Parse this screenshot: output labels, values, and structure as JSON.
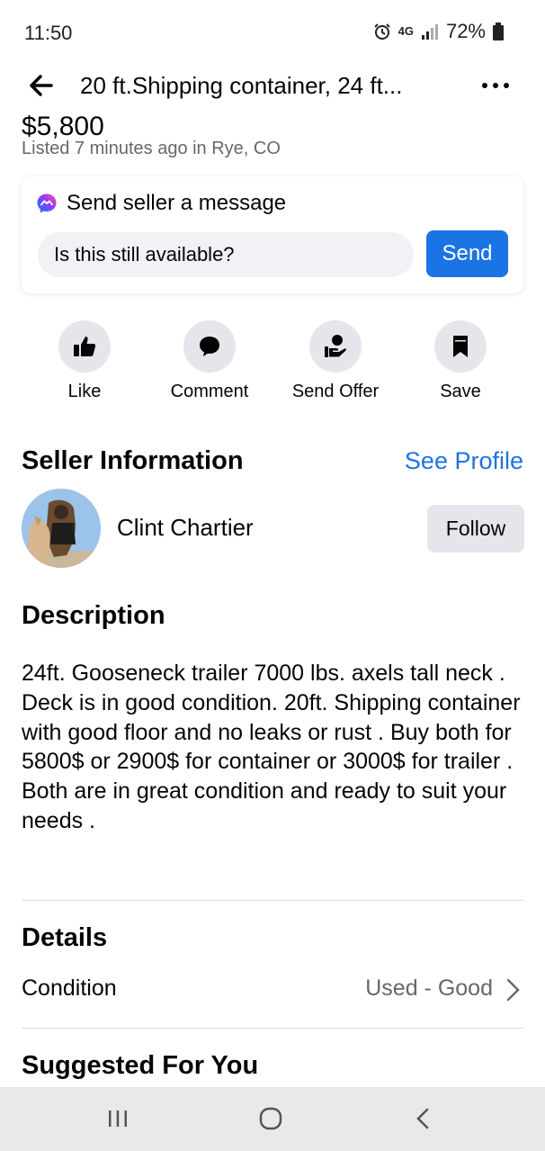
{
  "status_bar": {
    "time": "11:50",
    "network": "4G",
    "battery": "72%"
  },
  "header": {
    "title": "20 ft.Shipping container, 24 ft..."
  },
  "listing": {
    "price": "$5,800",
    "listed": "Listed 7 minutes ago in Rye, CO"
  },
  "message": {
    "header": "Send seller a message",
    "input_value": "Is this still available?",
    "send_label": "Send"
  },
  "actions": [
    {
      "label": "Like",
      "icon": "thumbs-up-icon"
    },
    {
      "label": "Comment",
      "icon": "comment-icon"
    },
    {
      "label": "Send Offer",
      "icon": "offer-icon"
    },
    {
      "label": "Save",
      "icon": "bookmark-icon"
    }
  ],
  "seller": {
    "section_title": "Seller Information",
    "see_profile": "See Profile",
    "name": "Clint Chartier",
    "follow_label": "Follow"
  },
  "description": {
    "section_title": "Description",
    "text": "24ft. Gooseneck trailer 7000 lbs. axels tall neck . Deck is in good condition. 20ft. Shipping container with good floor and no leaks or rust . Buy both for 5800$ or 2900$ for container or 3000$ for trailer . Both are in great condition and ready to suit your needs ."
  },
  "details": {
    "section_title": "Details",
    "condition_label": "Condition",
    "condition_value": "Used - Good"
  },
  "suggested": {
    "section_title": "Suggested For You"
  },
  "colors": {
    "accent": "#1b74e4",
    "muted_text": "#65676b",
    "button_bg": "#e4e6eb"
  }
}
